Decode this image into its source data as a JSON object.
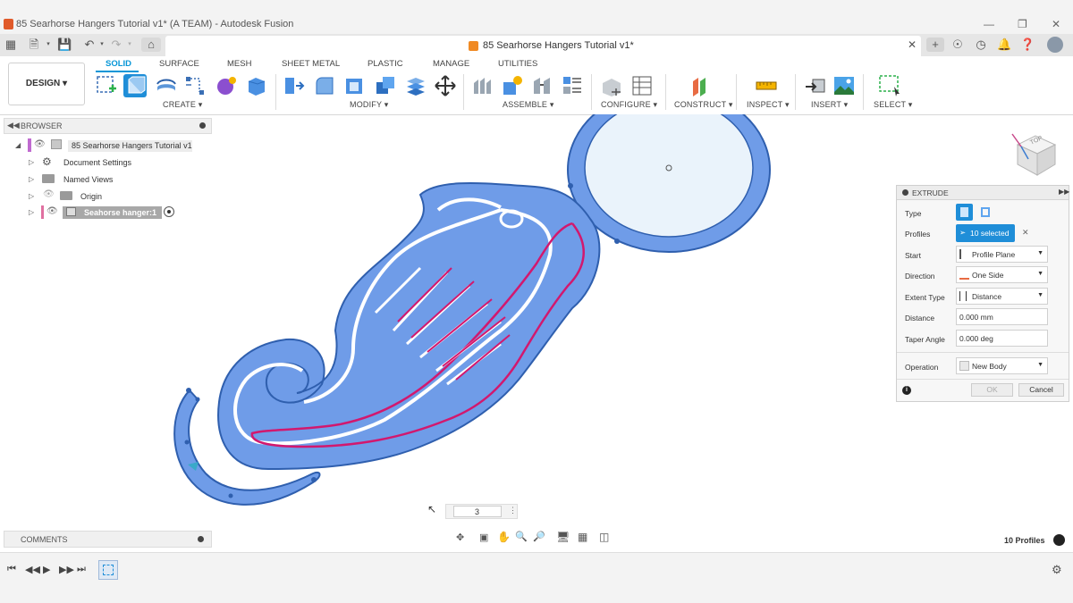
{
  "window": {
    "title": "85 Searhorse Hangers Tutorial v1* (A TEAM) - Autodesk Fusion"
  },
  "tab": {
    "label": "85 Searhorse Hangers Tutorial v1*"
  },
  "toolbar": {
    "workspace_button": "DESIGN",
    "workspace_tabs": [
      "SOLID",
      "SURFACE",
      "MESH",
      "SHEET METAL",
      "PLASTIC",
      "MANAGE",
      "UTILITIES"
    ],
    "groups": [
      "CREATE",
      "MODIFY",
      "ASSEMBLE",
      "CONFIGURE",
      "CONSTRUCT",
      "INSPECT",
      "INSERT",
      "SELECT"
    ]
  },
  "browser": {
    "title": "BROWSER",
    "items": [
      {
        "label": "85 Searhorse Hangers Tutorial v1"
      },
      {
        "label": "Document Settings"
      },
      {
        "label": "Named Views"
      },
      {
        "label": "Origin"
      },
      {
        "label": "Seahorse hanger:1"
      }
    ]
  },
  "extrude": {
    "title": "EXTRUDE",
    "type_label": "Type",
    "profiles_label": "Profiles",
    "profiles_value": "10 selected",
    "start_label": "Start",
    "start_value": "Profile Plane",
    "direction_label": "Direction",
    "direction_value": "One Side",
    "extent_label": "Extent Type",
    "extent_value": "Distance",
    "distance_label": "Distance",
    "distance_value": "0.000 mm",
    "taper_label": "Taper Angle",
    "taper_value": "0.000 deg",
    "operation_label": "Operation",
    "operation_value": "New Body",
    "ok_label": "OK",
    "cancel_label": "Cancel"
  },
  "canvas": {
    "distance_input": "3",
    "status": "10 Profiles",
    "viewcube_label": "TOP"
  },
  "comments": {
    "title": "COMMENTS"
  },
  "colors": {
    "accent": "#0696d7",
    "profile_fill": "#6f9ce8",
    "profile_outline": "#2f5fae",
    "highlight_pink": "#d2186e",
    "highlight_white": "#ffffff"
  }
}
